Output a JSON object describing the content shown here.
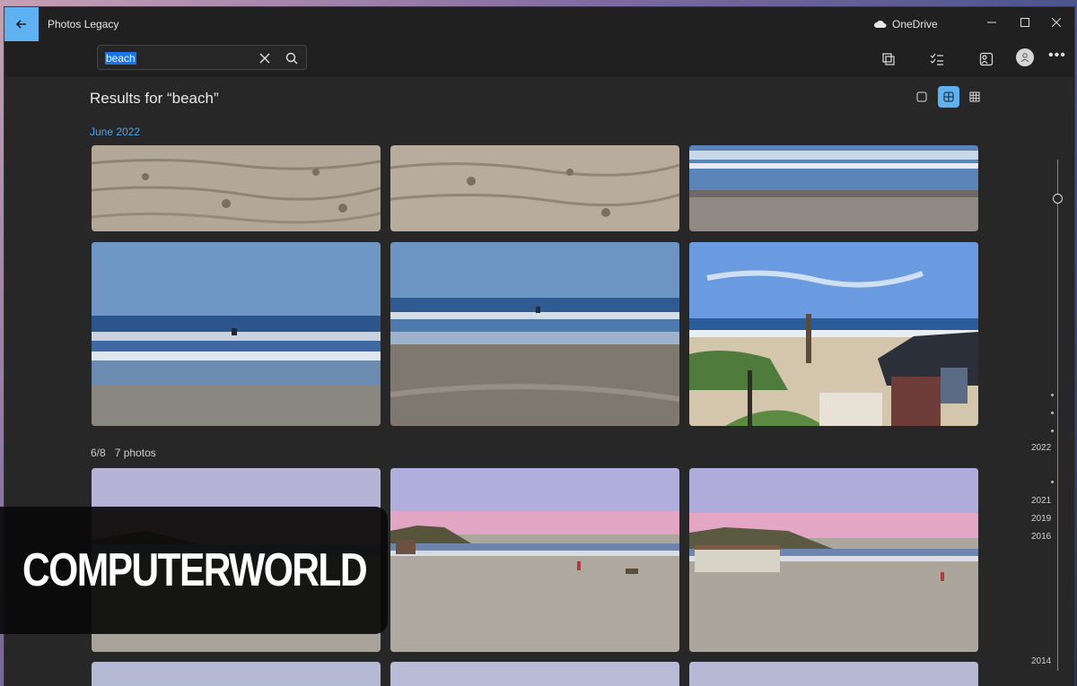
{
  "window": {
    "app_title": "Photos Legacy",
    "onedrive_label": "OneDrive"
  },
  "toolbar": {
    "search_value": "beach",
    "icons": [
      "import-icon",
      "select-icon",
      "people-icon",
      "account-avatar-icon",
      "more-icon"
    ]
  },
  "main": {
    "results_title": "Results for “beach”",
    "view_modes": [
      "single-view",
      "grid-view",
      "compact-grid-view"
    ],
    "active_view": "grid-view",
    "groups": [
      {
        "label": "June 2022",
        "label_color": "#4aa3f0",
        "photo_count": 6
      },
      {
        "label": "6/8",
        "sublabel": "7 photos",
        "photo_count": 7
      }
    ]
  },
  "timeline": {
    "years": [
      "2022",
      "2021",
      "2019",
      "2016",
      "2014"
    ]
  },
  "watermark": {
    "text": "COMPUTERWORLD"
  },
  "colors": {
    "accent": "#5fb2f2",
    "background": "#272727",
    "titlebar": "#202020"
  }
}
